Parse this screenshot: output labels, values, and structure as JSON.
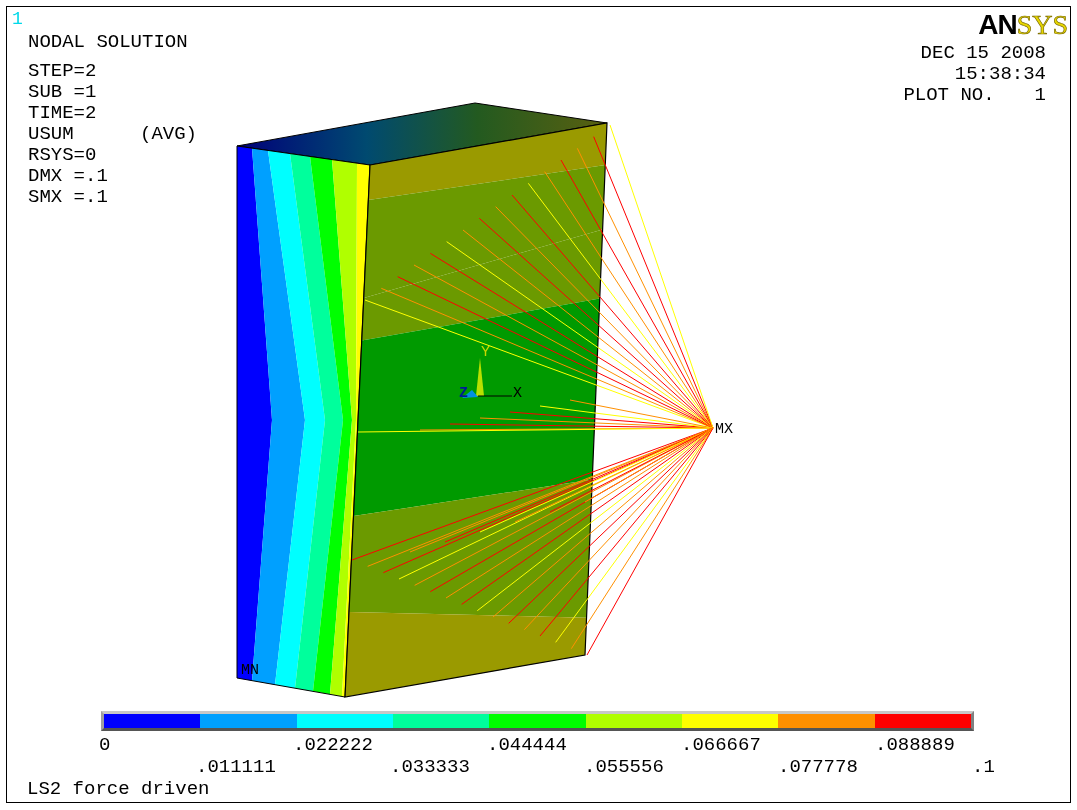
{
  "window_number": "1",
  "title": "NODAL SOLUTION",
  "info_lines": [
    "STEP=2",
    "SUB =1",
    "TIME=2"
  ],
  "result": {
    "quantity": "USUM",
    "averaging": "(AVG)"
  },
  "info_lines_after": [
    "RSYS=0",
    "DMX =.1",
    "SMX =.1"
  ],
  "logo": {
    "part_1": "AN",
    "part_2": "SYS"
  },
  "date": "DEC 15 2008",
  "time": "15:38:34",
  "plot_label": "PLOT NO.",
  "plot_number": "1",
  "model_labels": {
    "min": "MN",
    "max": "MX",
    "axis_x": "X",
    "axis_y": "Y",
    "axis_z": "Z"
  },
  "legend": {
    "bands": [
      {
        "color": "#0000ff"
      },
      {
        "color": "#00a0ff"
      },
      {
        "color": "#00ffff"
      },
      {
        "color": "#00ff9c"
      },
      {
        "color": "#00ff00"
      },
      {
        "color": "#b0ff00"
      },
      {
        "color": "#ffff00"
      },
      {
        "color": "#ff9000"
      },
      {
        "color": "#ff0000"
      }
    ],
    "ticks": [
      "0",
      ".011111",
      ".022222",
      ".033333",
      ".044444",
      ".055556",
      ".066667",
      ".077778",
      ".088889",
      ".1"
    ]
  },
  "subtitle": "LS2 force driven"
}
